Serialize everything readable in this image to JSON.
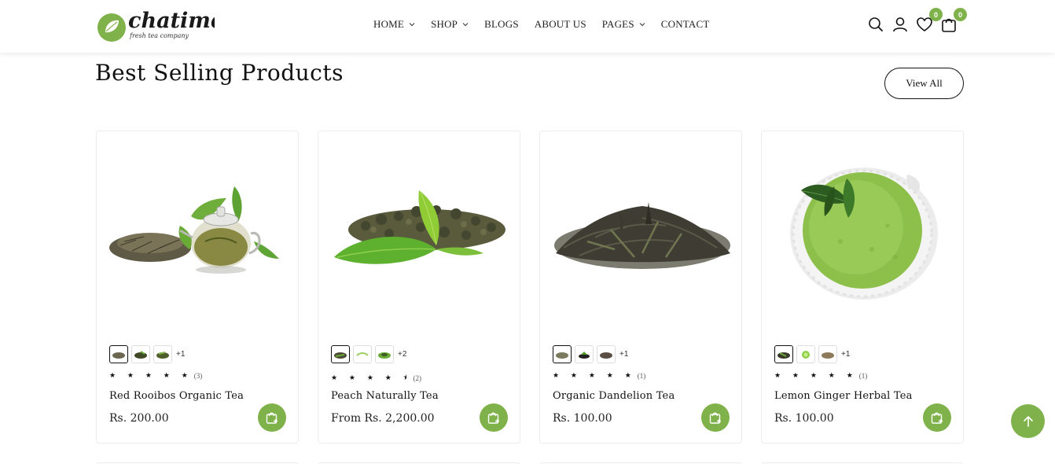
{
  "brand": {
    "logo_word": "chatime",
    "logo_tagline": "fresh tea company",
    "accent_color": "#7fb24a"
  },
  "nav": [
    {
      "label": "HOME",
      "dropdown": true
    },
    {
      "label": "SHOP",
      "dropdown": true
    },
    {
      "label": "BLOGS",
      "dropdown": false
    },
    {
      "label": "ABOUT US",
      "dropdown": false
    },
    {
      "label": "PAGES",
      "dropdown": true
    },
    {
      "label": "CONTACT",
      "dropdown": false
    }
  ],
  "header_icons": {
    "search": "search-icon",
    "account": "user-icon",
    "wishlist": "heart-icon",
    "wishlist_count": "0",
    "cart": "bag-icon",
    "cart_count": "0"
  },
  "section": {
    "title": "Best Selling Products",
    "view_all": "View All"
  },
  "products": [
    {
      "name": "Red Rooibos Organic Tea",
      "price": "Rs. 200.00",
      "stars": "★ ★ ★ ★ ★",
      "rating": 5,
      "reviews": "(3)",
      "more_swatches": "+1"
    },
    {
      "name": "Peach Naturally Tea",
      "price": "From Rs. 2,200.00",
      "stars": "★ ★ ★ ★ ⯨",
      "rating": 4.5,
      "reviews": "(2)",
      "more_swatches": "+2"
    },
    {
      "name": "Organic Dandelion Tea",
      "price": "Rs. 100.00",
      "stars": "★ ★ ★ ★ ★",
      "rating": 5,
      "reviews": "(1)",
      "more_swatches": "+1"
    },
    {
      "name": "Lemon Ginger Herbal Tea",
      "price": "Rs. 100.00",
      "stars": "★ ★ ★ ★ ★",
      "rating": 5,
      "reviews": "(1)",
      "more_swatches": "+1"
    }
  ]
}
